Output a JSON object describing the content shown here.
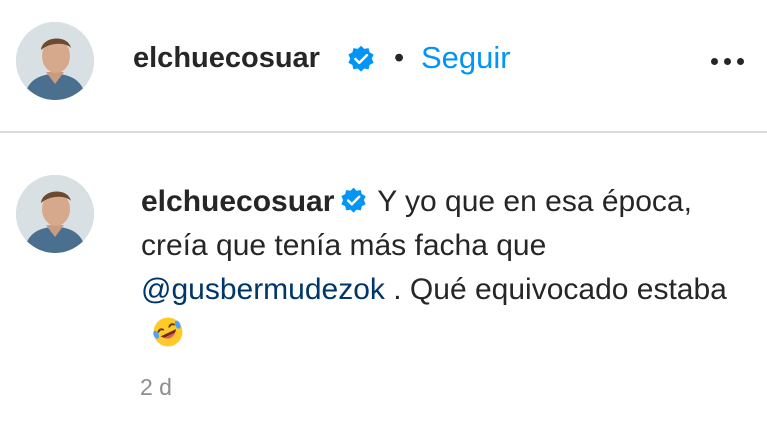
{
  "post_header": {
    "username": "elchuecosuar",
    "separator": "•",
    "follow_label": "Seguir",
    "more_icon": "more-horizontal-icon"
  },
  "comment": {
    "username": "elchuecosuar",
    "text_before_mention": "Y yo que en esa época, creía que tenía más facha que",
    "mention": "@gusbermudezok",
    "text_after_mention": ". Qué equivocado estaba",
    "emoji": "rolling-on-the-floor-laughing-emoji",
    "timestamp": "2 d"
  },
  "colors": {
    "link_blue": "#0095f6",
    "mention_blue": "#00376b",
    "verified_blue": "#0095f6",
    "text": "#262626",
    "muted": "#8e8e8e",
    "divider": "#dbdbdb"
  }
}
